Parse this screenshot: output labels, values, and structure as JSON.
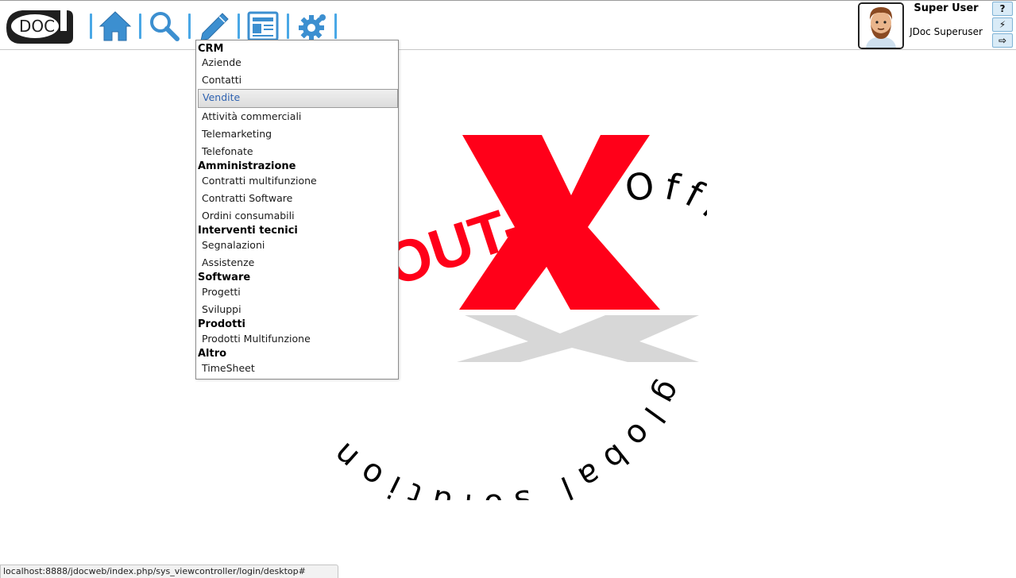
{
  "header": {
    "logo_text": "DOC",
    "nav_icons": [
      "home-icon",
      "search-icon",
      "pencil-icon",
      "document-icon",
      "gear-icon"
    ],
    "accent_color": "#4aa8e6"
  },
  "user": {
    "name": "Super User",
    "role": "JDoc Superuser",
    "buttons": [
      {
        "name": "help-button",
        "label": "?"
      },
      {
        "name": "lightning-button",
        "label": "⚡"
      },
      {
        "name": "logout-button",
        "label": "⇨"
      }
    ]
  },
  "menu": {
    "sections": [
      {
        "title": "CRM",
        "items": [
          "Aziende",
          "Contatti",
          "Vendite",
          "Attività commerciali",
          "Telemarketing",
          "Telefonate"
        ]
      },
      {
        "title": "Amministrazione",
        "items": [
          "Contratti multifunzione",
          "Contratti Software",
          "Ordini consumabili"
        ]
      },
      {
        "title": "Interventi tecnici",
        "items": [
          "Segnalazioni",
          "Assistenze"
        ]
      },
      {
        "title": "Software",
        "items": [
          "Progetti",
          "Sviluppi"
        ]
      },
      {
        "title": "Prodotti",
        "items": [
          "Prodotti Multifunzione"
        ]
      },
      {
        "title": "Altro",
        "items": [
          "TimeSheet"
        ]
      }
    ],
    "active_item": "Vendite"
  },
  "background_logo": {
    "brand_partial": "OUT-",
    "brand_letter": "X",
    "office_text": "Office",
    "tagline": "global solution",
    "brand_color": "#ff0019"
  },
  "status_bar": {
    "url": "localhost:8888/jdocweb/index.php/sys_viewcontroller/login/desktop#"
  }
}
